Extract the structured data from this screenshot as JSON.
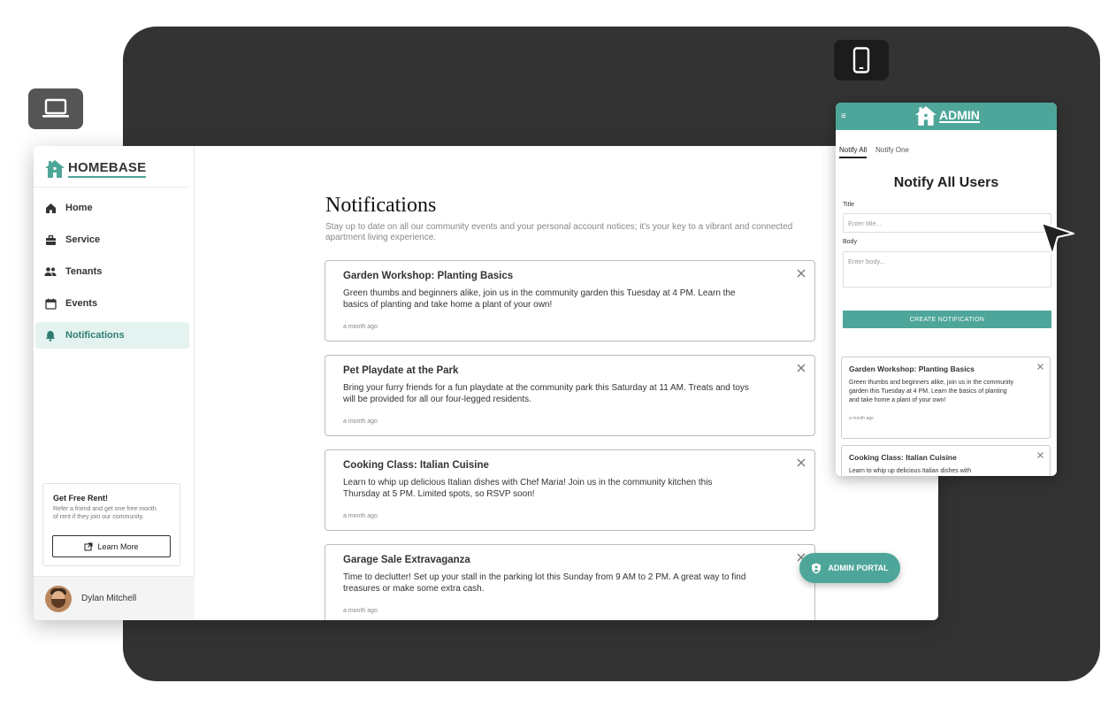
{
  "brand": {
    "name": "HOMEBASE",
    "accent": "#4ea69a",
    "dark_bg": "#333333"
  },
  "sidebar": {
    "items": [
      {
        "label": "Home",
        "icon": "home-icon"
      },
      {
        "label": "Service",
        "icon": "briefcase-icon"
      },
      {
        "label": "Tenants",
        "icon": "people-icon"
      },
      {
        "label": "Events",
        "icon": "calendar-icon"
      },
      {
        "label": "Notifications",
        "icon": "bell-icon",
        "active": true
      }
    ],
    "promo": {
      "title": "Get Free Rent!",
      "text": "Refer a friend and get one free month of rent if they join our community.",
      "button": "Learn More"
    },
    "user": {
      "name": "Dylan Mitchell"
    }
  },
  "main": {
    "title": "Notifications",
    "subtitle": "Stay up to date on all our community events and your personal account notices; it's your key to a vibrant and connected apartment living experience.",
    "notifications": [
      {
        "title": "Garden Workshop: Planting Basics",
        "body": "Green thumbs and beginners alike, join us in the community garden this Tuesday at 4 PM. Learn the basics of planting and take home a plant of your own!",
        "time": "a month ago"
      },
      {
        "title": "Pet Playdate at the Park",
        "body": "Bring your furry friends for a fun playdate at the community park this Saturday at 11 AM. Treats and toys will be provided for all our four-legged residents.",
        "time": "a month ago"
      },
      {
        "title": "Cooking Class: Italian Cuisine",
        "body": "Learn to whip up delicious Italian dishes with Chef Maria! Join us in the community kitchen this Thursday at 5 PM. Limited spots, so RSVP soon!",
        "time": "a month ago"
      },
      {
        "title": "Garage Sale Extravaganza",
        "body": "Time to declutter! Set up your stall in the parking lot this Sunday from 9 AM to 2 PM. A great way to find treasures or make some extra cash.",
        "time": "a month ago"
      }
    ],
    "admin_portal": "ADMIN PORTAL"
  },
  "mobile": {
    "logo": "ADMIN",
    "tabs": [
      "Notify All",
      "Notify One"
    ],
    "title": "Notify All Users",
    "title_label": "Title",
    "title_placeholder": "Enter title...",
    "body_label": "Body",
    "body_placeholder": "Enter body...",
    "create_button": "CREATE NOTIFICATION",
    "notifications": [
      {
        "title": "Garden Workshop: Planting Basics",
        "body": "Green thumbs and beginners alike, join us in the community garden this Tuesday at 4 PM. Learn the basics of planting and take home a plant of your own!",
        "time": "a month ago"
      },
      {
        "title": "Cooking Class: Italian Cuisine",
        "body": "Learn to whip up delicious Italian dishes with",
        "time": ""
      }
    ]
  }
}
